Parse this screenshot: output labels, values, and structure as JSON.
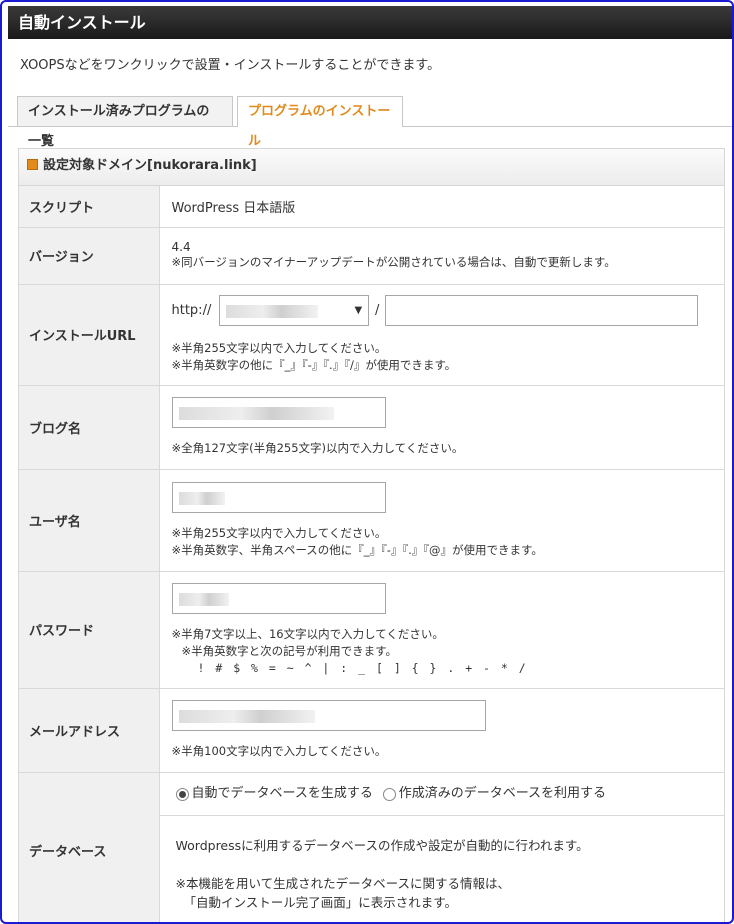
{
  "window": {
    "title": "自動インストール"
  },
  "description": "XOOPSなどをワンクリックで設置・インストールすることができます。",
  "tabs": [
    {
      "label": "インストール済みプログラムの一覧",
      "active": false
    },
    {
      "label": "プログラムのインストール",
      "active": true
    }
  ],
  "panel": {
    "heading": "設定対象ドメイン[nukorara.link]",
    "rows": {
      "script": {
        "label": "スクリプト",
        "value": "WordPress 日本語版"
      },
      "version": {
        "label": "バージョン",
        "value": "4.4",
        "note": "※同バージョンのマイナーアップデートが公開されている場合は、自動で更新します。"
      },
      "url": {
        "label": "インストールURL",
        "prefix": "http://",
        "separator": "/",
        "note1": "※半角255文字以内で入力してください。",
        "note2": "※半角英数字の他に『_』『-』『.』『/』が使用できます。"
      },
      "blog": {
        "label": "ブログ名",
        "note": "※全角127文字(半角255文字)以内で入力してください。"
      },
      "user": {
        "label": "ユーザ名",
        "note1": "※半角255文字以内で入力してください。",
        "note2": "※半角英数字、半角スペースの他に『_』『-』『.』『@』が使用できます。"
      },
      "password": {
        "label": "パスワード",
        "note1": "※半角7文字以上、16文字以内で入力してください。",
        "note2": "※半角英数字と次の記号が利用できます。",
        "symbols": "! # $ % = ~ ^ | : _ [ ] { } . + - * /"
      },
      "email": {
        "label": "メールアドレス",
        "note": "※半角100文字以内で入力してください。"
      },
      "database": {
        "label": "データベース",
        "option1": "自動でデータベースを生成する",
        "option2": "作成済みのデータベースを利用する",
        "info1": "Wordpressに利用するデータベースの作成や設定が自動的に行われます。",
        "info2": "※本機能を用いて生成されたデータベースに関する情報は、",
        "info3": "「自動インストール完了画面」に表示されます。"
      }
    }
  },
  "colors": {
    "active_tab": "#e08a1e",
    "frame_border": "#1a1ad0",
    "heading_marker": "#e38a1a"
  }
}
